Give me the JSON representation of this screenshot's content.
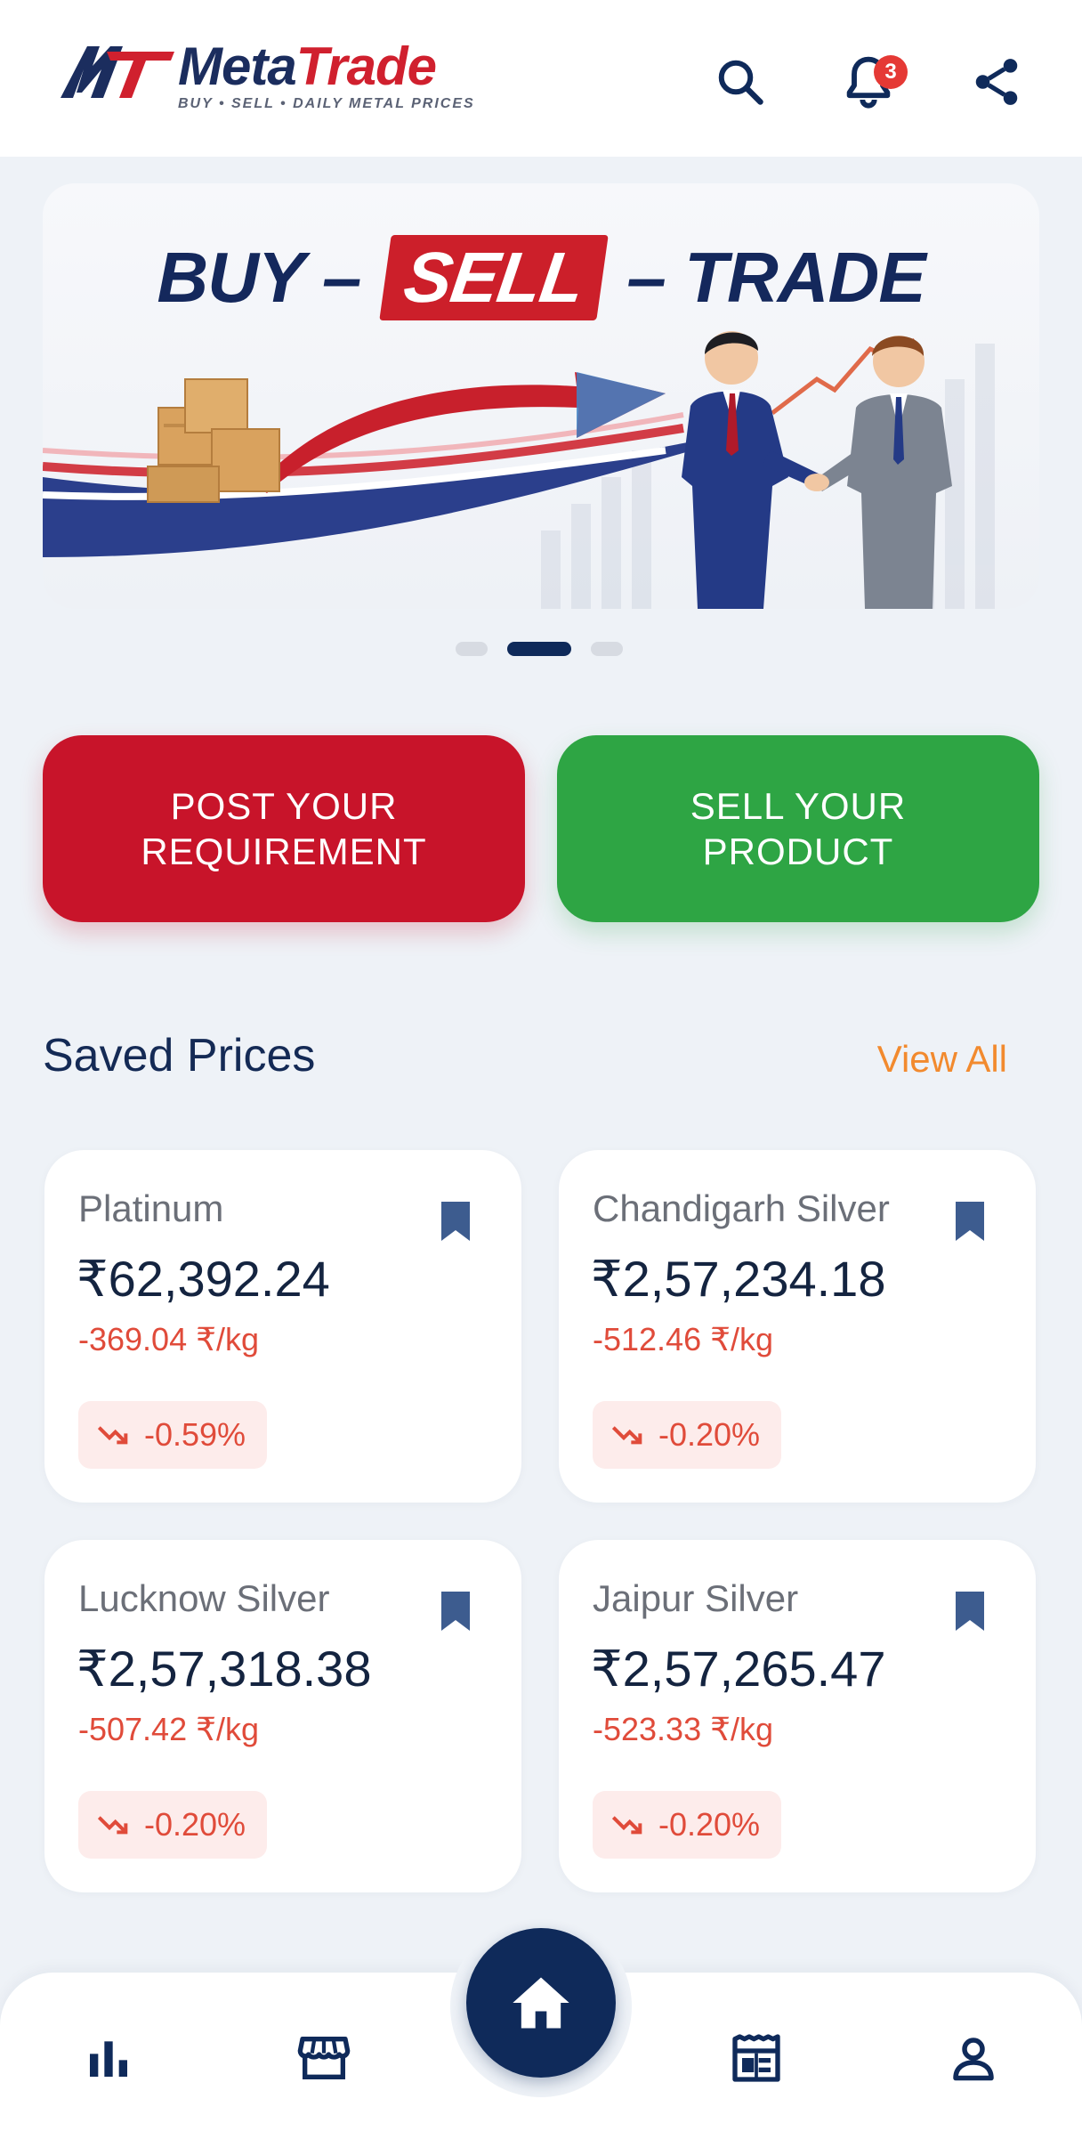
{
  "header": {
    "brand_meta": "Meta",
    "brand_trade": "Trade",
    "tagline": "BUY • SELL • DAILY METAL PRICES",
    "notification_count": "3"
  },
  "banner": {
    "headline_left": "BUY –",
    "headline_sell": "SELL",
    "headline_right": "– TRADE",
    "active_slide": 2,
    "slide_count": 3
  },
  "actions": {
    "post_requirement": "POST YOUR REQUIREMENT",
    "sell_product": "SELL YOUR PRODUCT"
  },
  "saved_prices": {
    "title": "Saved Prices",
    "view_all": "View All",
    "items": [
      {
        "name": "Platinum",
        "price": "₹62,392.24",
        "change": "-369.04 ₹/kg",
        "percent": "-0.59%"
      },
      {
        "name": "Chandigarh Silver",
        "price": "₹2,57,234.18",
        "change": "-512.46 ₹/kg",
        "percent": "-0.20%"
      },
      {
        "name": "Lucknow Silver",
        "price": "₹2,57,318.38",
        "change": "-507.42 ₹/kg",
        "percent": "-0.20%"
      },
      {
        "name": "Jaipur Silver",
        "price": "₹2,57,265.47",
        "change": "-523.33 ₹/kg",
        "percent": "-0.20%"
      }
    ]
  },
  "nav": {
    "items": [
      "chart-icon",
      "store-icon",
      "home-icon",
      "news-icon",
      "profile-icon"
    ],
    "active": "home-icon"
  },
  "colors": {
    "primary_navy": "#0f2a5a",
    "red": "#c8142a",
    "green": "#2ea544",
    "accent_orange": "#f28a2e",
    "negative": "#e04b3a"
  }
}
